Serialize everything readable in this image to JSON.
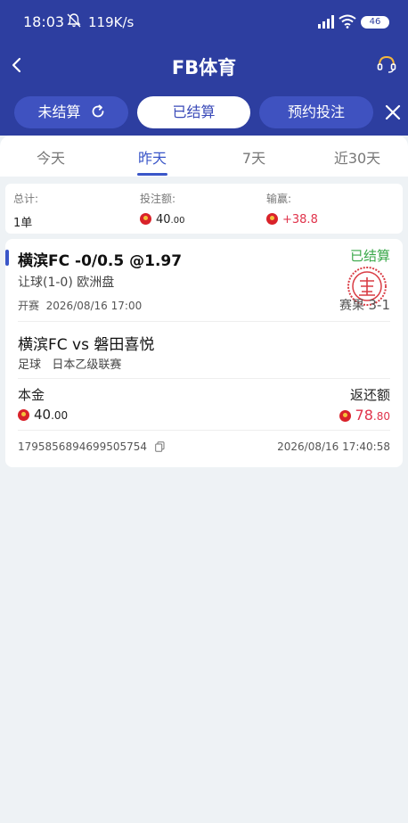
{
  "status_bar": {
    "time": "18:03",
    "network_speed": "119K/s",
    "battery": "46",
    "icons": [
      "mute-icon",
      "signal-icon",
      "wifi-icon",
      "battery-icon"
    ]
  },
  "nav": {
    "title": "FB体育",
    "back_icon": "chevron-left-icon",
    "support_icon": "headset-icon"
  },
  "filter_tabs": [
    {
      "label": "未结算",
      "active": false,
      "icon": "refresh-icon"
    },
    {
      "label": "已结算",
      "active": true
    },
    {
      "label": "预约投注",
      "active": false
    }
  ],
  "close_icon": "close-icon",
  "date_tabs": [
    {
      "label": "今天",
      "active": false
    },
    {
      "label": "昨天",
      "active": true
    },
    {
      "label": "7天",
      "active": false
    },
    {
      "label": "近30天",
      "active": false
    }
  ],
  "summary": {
    "total_label": "总计:",
    "total_value": "1单",
    "stake_label": "投注额:",
    "stake_int": "40",
    "stake_dec": ".00",
    "winloss_label": "输赢:",
    "winloss_value": "+38.8"
  },
  "bet": {
    "title": "横滨FC -0/0.5 @1.97",
    "status": "已结算",
    "market": "让球(1-0) 欧洲盘",
    "kickoff_label": "开赛",
    "kickoff_time": "2026/08/16 17:00",
    "score_label": "赛果",
    "score_value": "3-1",
    "match": "横滨FC vs 磐田喜悦",
    "sport": "足球",
    "league": "日本乙级联赛",
    "principal_label": "本金",
    "principal_int": "40",
    "principal_dec": ".00",
    "return_label": "返还额",
    "return_int": "78",
    "return_dec": ".80",
    "order_no": "1795856894699505754",
    "settle_time": "2026/08/16 17:40:58"
  },
  "colors": {
    "header_bg": "#2d3ea0",
    "accent": "#3a56c8",
    "win_red": "#e0334b",
    "settled_green": "#3aa84a",
    "page_bg": "#eef2f5"
  }
}
